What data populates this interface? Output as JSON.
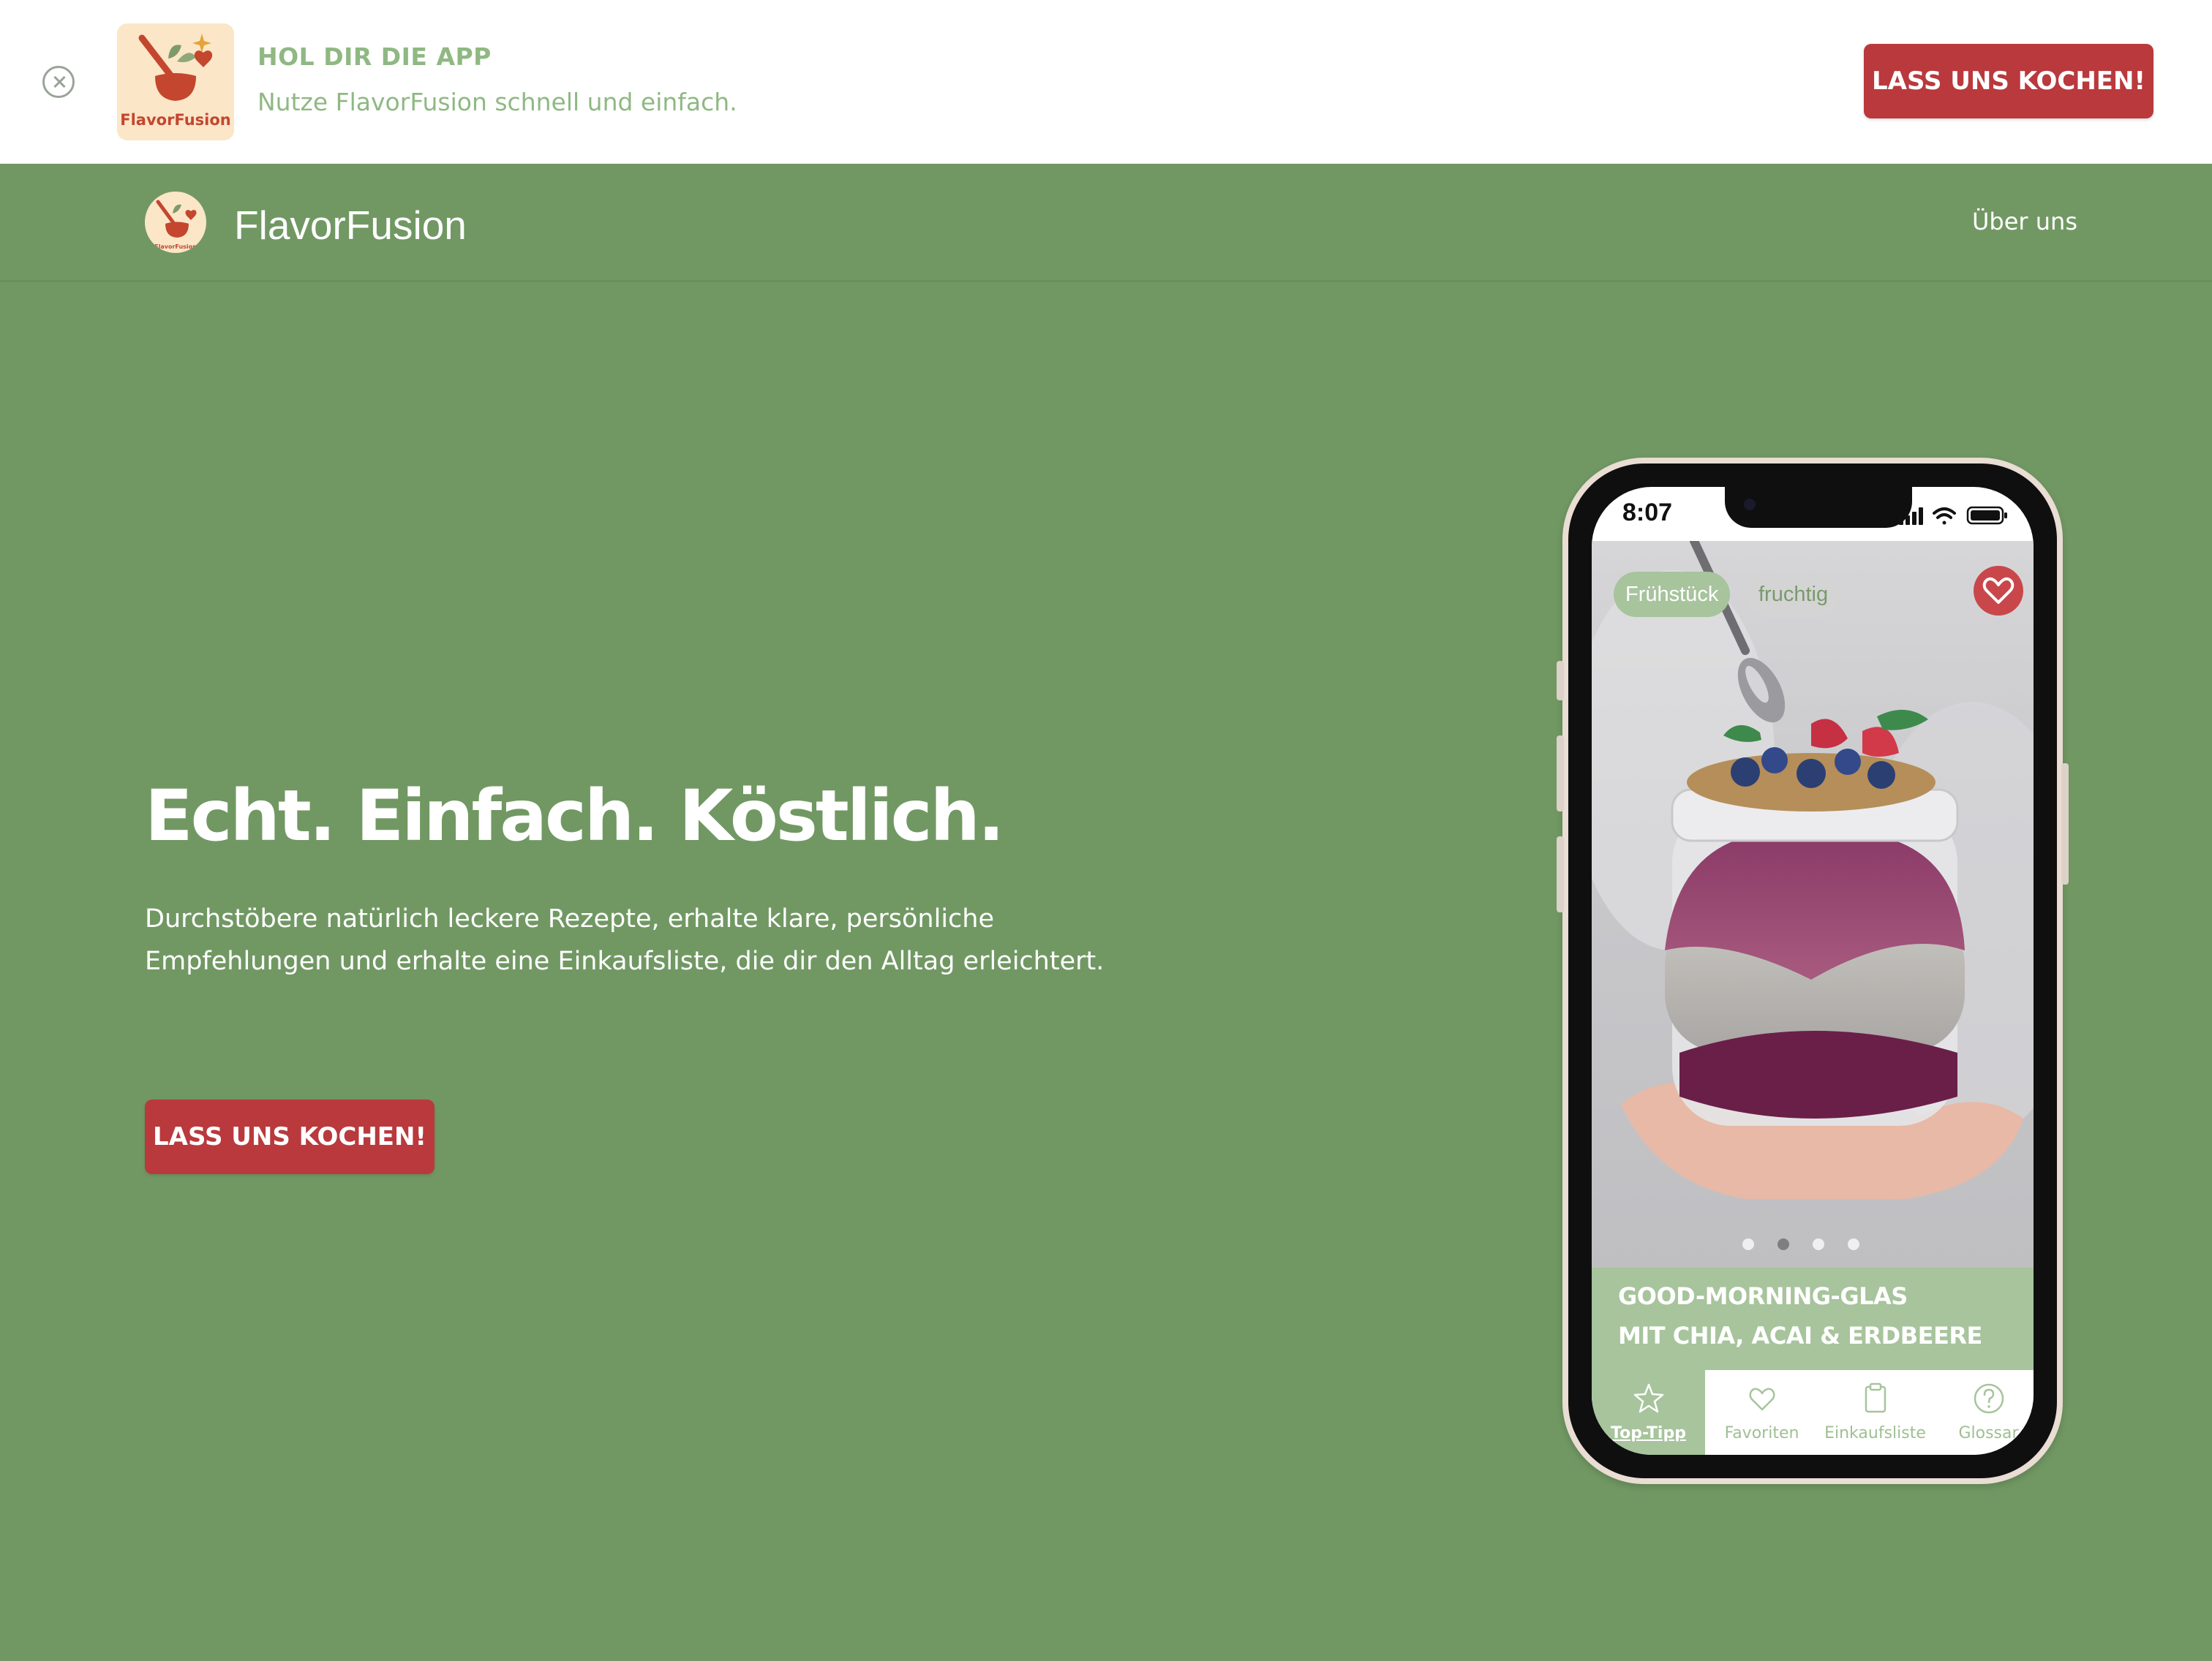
{
  "banner": {
    "title": "HOL DIR DIE APP",
    "subtitle": "Nutze FlavorFusion schnell und einfach.",
    "cta_label": "LASS UNS KOCHEN!",
    "app_icon_label": "FlavorFusion",
    "close_icon": "close-circle-icon"
  },
  "nav": {
    "brand": "FlavorFusion",
    "links": [
      "Über uns"
    ]
  },
  "hero": {
    "title": "Echt. Einfach. Köstlich.",
    "text": "Durchstöbere natürlich leckere Rezepte, erhalte klare, persönliche Empfehlungen und erhalte eine Einkaufsliste, die dir den Alltag erleichtert.",
    "cta_label": "LASS UNS KOCHEN!"
  },
  "phone": {
    "status_time": "8:07",
    "tags": [
      "Frühstück",
      "fruchtig"
    ],
    "carousel": {
      "count": 4,
      "active": 1
    },
    "recipe_title_lines": [
      "GOOD-MORNING-GLAS",
      "MIT CHIA, ACAI & ERDBEERE"
    ],
    "tabs": [
      {
        "label": "Top-Tipp",
        "icon": "star-icon",
        "active": true
      },
      {
        "label": "Favoriten",
        "icon": "heart-icon",
        "active": false
      },
      {
        "label": "Einkaufsliste",
        "icon": "clipboard-icon",
        "active": false
      },
      {
        "label": "Glossar",
        "icon": "help-circle-icon",
        "active": false
      }
    ]
  },
  "colors": {
    "page_bg": "#719863",
    "accent_red": "#b9393d",
    "light_green": "#a7c49c",
    "banner_text": "#8fb883"
  }
}
